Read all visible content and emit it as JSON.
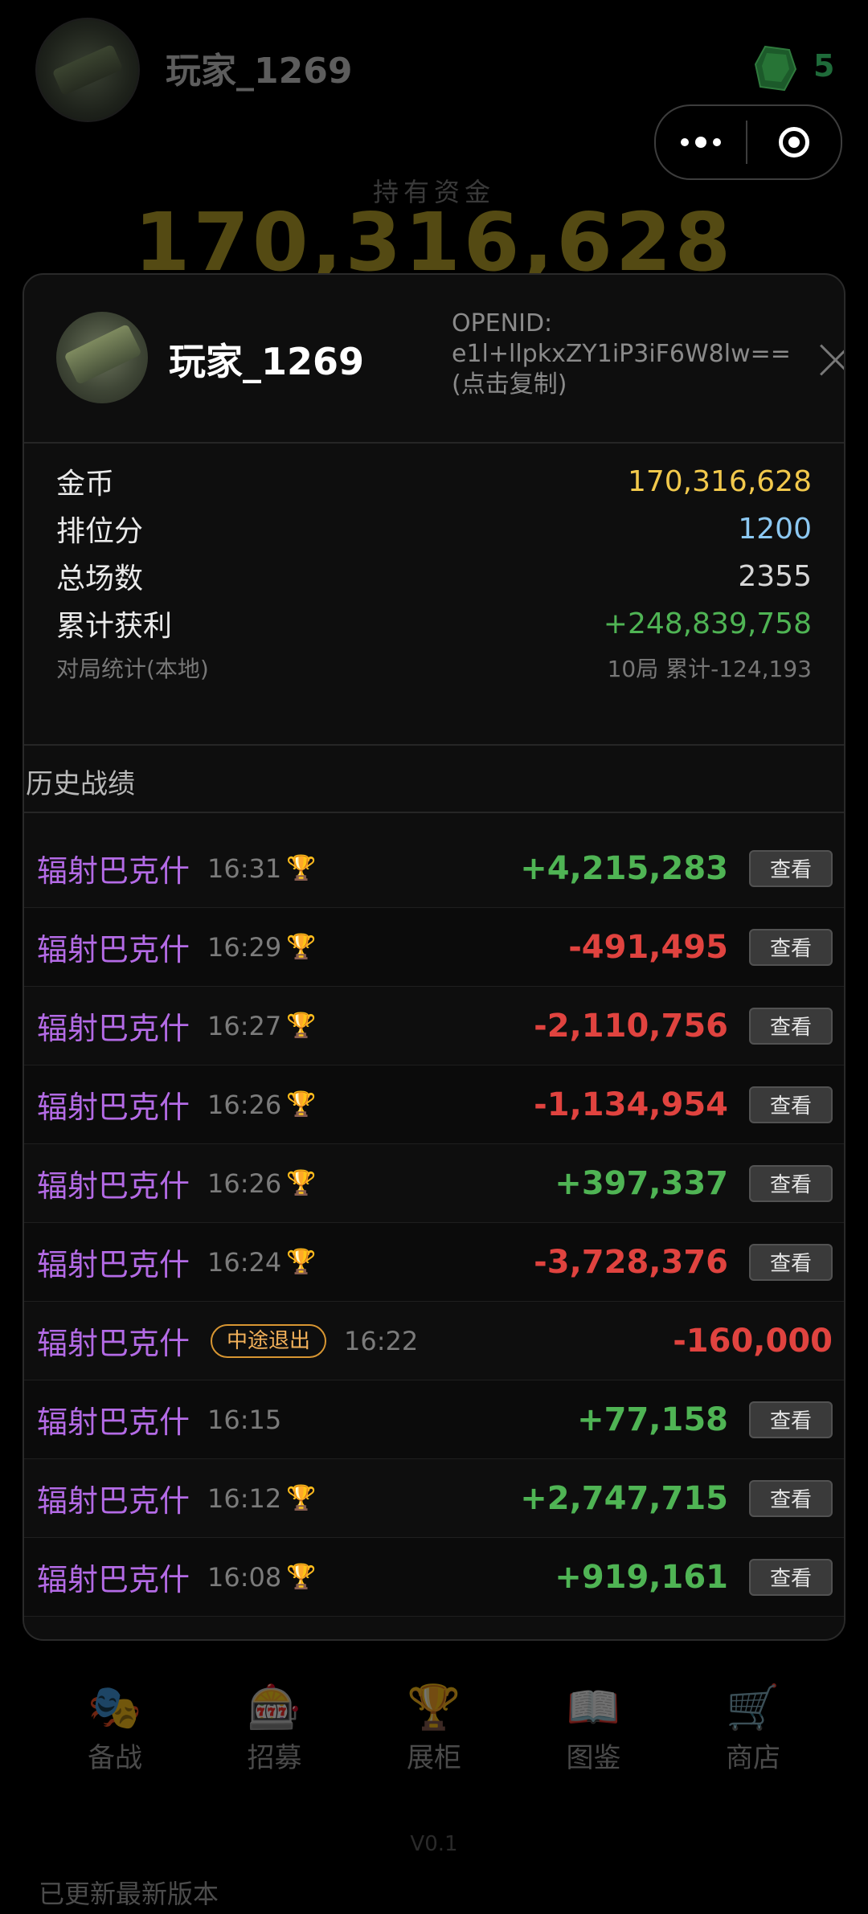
{
  "top": {
    "player_name": "玩家_1269",
    "gem_count": "5",
    "funds_label": "持有资金",
    "funds_value": "170,316,628"
  },
  "modal": {
    "player_name": "玩家_1269",
    "openid_line1": "OPENID:",
    "openid_line2": "e1l+llpkxZY1iP3iF6W8lw==",
    "openid_line3": "(点击复制)",
    "stats": [
      {
        "label": "金币",
        "value": "170,316,628",
        "color": "#f2c94c"
      },
      {
        "label": "排位分",
        "value": "1200",
        "color": "#8cc8f2"
      },
      {
        "label": "总场数",
        "value": "2355",
        "color": "#d6d6d6"
      },
      {
        "label": "累计获利",
        "value": "+248,839,758",
        "color": "#4fb454"
      }
    ],
    "local_stats_label": "对局统计(本地)",
    "local_stats_value": "10局 累计-124,193",
    "history_title": "历史战绩",
    "view_label": "查看",
    "history": [
      {
        "mode": "辐射巴克什",
        "time": "16:31",
        "amount": "+4,215,283"
      },
      {
        "mode": "辐射巴克什",
        "time": "16:29",
        "amount": "-491,495"
      },
      {
        "mode": "辐射巴克什",
        "time": "16:27",
        "amount": "-2,110,756"
      },
      {
        "mode": "辐射巴克什",
        "time": "16:26",
        "amount": "-1,134,954"
      },
      {
        "mode": "辐射巴克什",
        "time": "16:26",
        "amount": "+397,337"
      },
      {
        "mode": "辐射巴克什",
        "time": "16:24",
        "amount": "-3,728,376"
      },
      {
        "mode": "辐射巴克什",
        "badge": "中途退出",
        "time": "16:22",
        "amount": "-160,000"
      },
      {
        "mode": "辐射巴克什",
        "time": "16:15",
        "amount": "+77,158"
      },
      {
        "mode": "辐射巴克什",
        "time": "16:12",
        "amount": "+2,747,715"
      },
      {
        "mode": "辐射巴克什",
        "time": "16:08",
        "amount": "+919,161"
      }
    ]
  },
  "nav": [
    {
      "label": "备战",
      "icon": "masks-icon",
      "glyph": "🎭"
    },
    {
      "label": "招募",
      "icon": "slot-machine-icon",
      "glyph": "🎰"
    },
    {
      "label": "展柜",
      "icon": "trophy-icon",
      "glyph": "🏆"
    },
    {
      "label": "图鉴",
      "icon": "book-icon",
      "glyph": "📖"
    },
    {
      "label": "商店",
      "icon": "cart-icon",
      "glyph": "🛒"
    }
  ],
  "footer": {
    "version": "V0.1",
    "update_note": "已更新最新版本"
  }
}
